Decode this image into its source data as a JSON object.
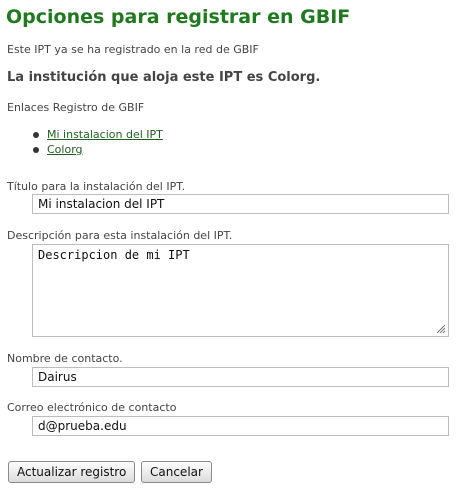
{
  "page": {
    "title": "Opciones para registrar en GBIF",
    "registered_info": "Este IPT ya se ha registrado en la red de GBIF",
    "host_institution": "La institución que aloja este IPT es Colorg.",
    "links_label": "Enlaces Registro de GBIF",
    "links": [
      {
        "label": "Mi instalacion del IPT"
      },
      {
        "label": "Colorg"
      }
    ]
  },
  "form": {
    "title_label": "Título para la instalación del IPT.",
    "title_value": "Mi instalacion del IPT",
    "description_label": "Descripción para esta instalación del IPT.",
    "description_value": "Descripcion de mi IPT",
    "contact_name_label": "Nombre de contacto.",
    "contact_name_value": "Dairus",
    "contact_email_label": "Correo electrónico de contacto",
    "contact_email_value": "d@prueba.edu"
  },
  "buttons": {
    "update_label": "Actualizar registro",
    "cancel_label": "Cancelar"
  },
  "colors": {
    "title": "#1f7a1f",
    "link": "#1f5f1f"
  }
}
